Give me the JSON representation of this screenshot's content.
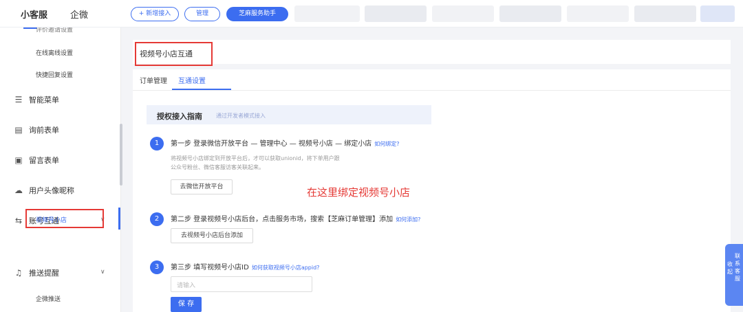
{
  "topbar": {
    "brand": "小客服",
    "tab": "企微",
    "add_btn": "+ 新增接入",
    "manage_btn": "管理",
    "assistant_btn": "芝麻服务助手"
  },
  "sidebar": {
    "cut_item": "评价邀请设置",
    "online_offline": "在线离线设置",
    "quick_reply": "快捷回复设置",
    "smart_menu": "智能菜单",
    "pre_form": "询前表单",
    "leave_form": "留言表单",
    "avatar_nick": "用户头像昵称",
    "account_link": "账号互通",
    "video_shop": "视频号小店",
    "push_remind": "推送提醒",
    "wecom_push": "企微推送"
  },
  "page": {
    "title": "视频号小店互通",
    "tabs": [
      "订单管理",
      "互通设置"
    ]
  },
  "guide": {
    "title": "授权接入指南",
    "subtitle": "通过开发者模式接入"
  },
  "steps": [
    {
      "num": "1",
      "title": "第一步 登录微信开放平台 — 管理中心 — 视频号小店 — 绑定小店",
      "link": "如何绑定?",
      "desc1": "将视频号小店绑定到开放平台后，才可以获取unionid，将下单用户跟",
      "desc2": "公众号粉丝、微信客服访客关联起来。",
      "button": "去微信开放平台"
    },
    {
      "num": "2",
      "title": "第二步 登录视频号小店后台，点击服务市场，搜索【芝麻订单管理】添加",
      "link": "如何添加?",
      "button": "去视频号小店后台添加"
    },
    {
      "num": "3",
      "title": "第三步 填写视频号小店ID",
      "link": "如何获取视频号小店appid?",
      "placeholder": "请输入",
      "button": "保 存"
    }
  ],
  "annotation": "在这里绑定视频号小店",
  "float_panel": {
    "collapse": "收起",
    "contact": "联系客服"
  },
  "colors": {
    "accent": "#3c6df0",
    "annotation": "#e53935"
  }
}
